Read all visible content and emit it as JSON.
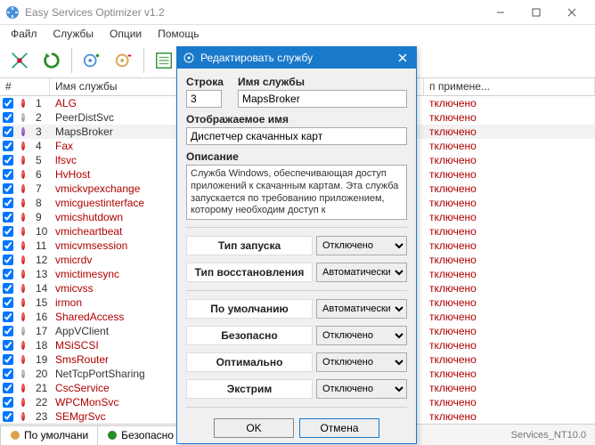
{
  "window": {
    "title": "Easy Services Optimizer v1.2"
  },
  "menu": {
    "file": "Файл",
    "services": "Службы",
    "options": "Опции",
    "help": "Помощь"
  },
  "table": {
    "headers": {
      "num": "#",
      "name": "Имя службы",
      "app": "п примене..."
    },
    "status_text": "тключено",
    "rows": [
      {
        "n": "1",
        "svc": "ALG",
        "color": "red",
        "dot": "red",
        "chk": true
      },
      {
        "n": "2",
        "svc": "PeerDistSvc",
        "color": "gray",
        "dot": "gray",
        "chk": true
      },
      {
        "n": "3",
        "svc": "MapsBroker",
        "color": "gray",
        "dot": "purple",
        "chk": true,
        "sel": true
      },
      {
        "n": "4",
        "svc": "Fax",
        "color": "red",
        "dot": "red",
        "chk": true
      },
      {
        "n": "5",
        "svc": "lfsvc",
        "color": "red",
        "dot": "red",
        "chk": true
      },
      {
        "n": "6",
        "svc": "HvHost",
        "color": "red",
        "dot": "red",
        "chk": true
      },
      {
        "n": "7",
        "svc": "vmickvpexchange",
        "color": "red",
        "dot": "red",
        "chk": true
      },
      {
        "n": "8",
        "svc": "vmicguestinterface",
        "color": "red",
        "dot": "red",
        "chk": true
      },
      {
        "n": "9",
        "svc": "vmicshutdown",
        "color": "red",
        "dot": "red",
        "chk": true
      },
      {
        "n": "10",
        "svc": "vmicheartbeat",
        "color": "red",
        "dot": "red",
        "chk": true
      },
      {
        "n": "11",
        "svc": "vmicvmsession",
        "color": "red",
        "dot": "red",
        "chk": true
      },
      {
        "n": "12",
        "svc": "vmicrdv",
        "color": "red",
        "dot": "red",
        "chk": true
      },
      {
        "n": "13",
        "svc": "vmictimesync",
        "color": "red",
        "dot": "red",
        "chk": true
      },
      {
        "n": "14",
        "svc": "vmicvss",
        "color": "red",
        "dot": "red",
        "chk": true
      },
      {
        "n": "15",
        "svc": "irmon",
        "color": "red",
        "dot": "red",
        "chk": true
      },
      {
        "n": "16",
        "svc": "SharedAccess",
        "color": "red",
        "dot": "red",
        "chk": true
      },
      {
        "n": "17",
        "svc": "AppVClient",
        "color": "gray",
        "dot": "gray",
        "chk": true
      },
      {
        "n": "18",
        "svc": "MSiSCSI",
        "color": "red",
        "dot": "red",
        "chk": true
      },
      {
        "n": "19",
        "svc": "SmsRouter",
        "color": "red",
        "dot": "red",
        "chk": true
      },
      {
        "n": "20",
        "svc": "NetTcpPortSharing",
        "color": "gray",
        "dot": "gray",
        "chk": true
      },
      {
        "n": "21",
        "svc": "CscService",
        "color": "red",
        "dot": "red",
        "chk": true
      },
      {
        "n": "22",
        "svc": "WPCMonSvc",
        "color": "red",
        "dot": "red",
        "chk": true
      },
      {
        "n": "23",
        "svc": "SEMgrSvc",
        "color": "red",
        "dot": "red",
        "chk": true
      }
    ]
  },
  "tabs": {
    "default": "По умолчани",
    "safe": "Безопасно"
  },
  "statusbar": {
    "right": "Services_NT10.0"
  },
  "modal": {
    "title": "Редактировать службу",
    "labels": {
      "row": "Строка",
      "name": "Имя службы",
      "display": "Отображаемое имя",
      "desc": "Описание",
      "start_type": "Тип запуска",
      "recovery": "Тип восстановления",
      "default": "По умолчанию",
      "safe": "Безопасно",
      "optimal": "Оптимально",
      "extreme": "Экстрим"
    },
    "values": {
      "row": "3",
      "name": "MapsBroker",
      "display": "Диспетчер скачанных карт",
      "desc": "Служба Windows, обеспечивающая доступ приложений к скачанным картам. Эта служба запускается по требованию приложением, которому необходим доступ к",
      "start_type": "Отключено",
      "recovery": "Автоматически",
      "default": "Автоматически",
      "safe": "Отключено",
      "optimal": "Отключено",
      "extreme": "Отключено"
    },
    "buttons": {
      "ok": "OK",
      "cancel": "Отмена"
    }
  }
}
